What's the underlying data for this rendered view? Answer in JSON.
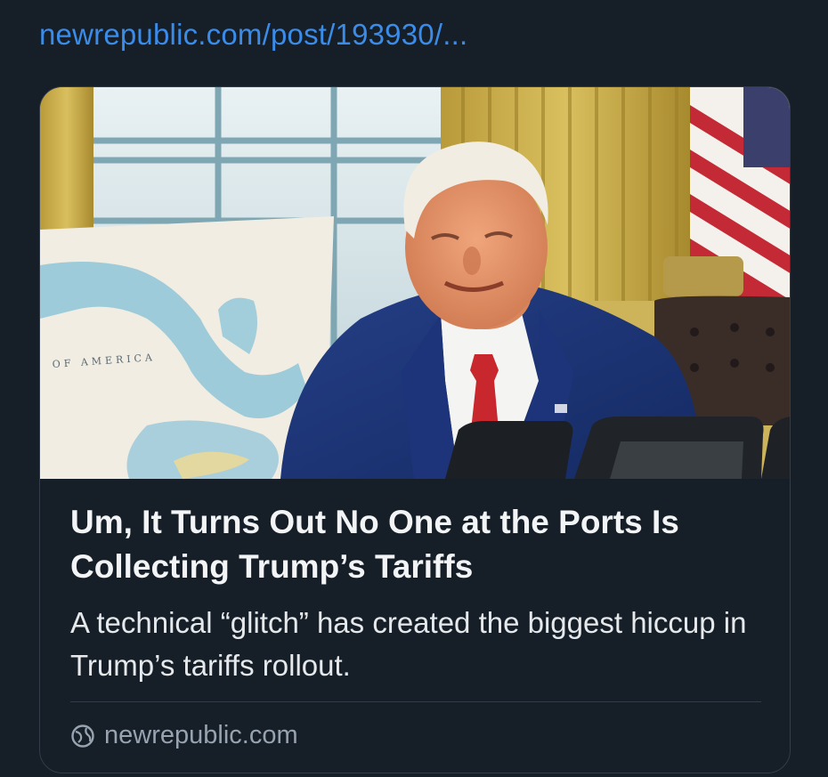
{
  "link": {
    "url_text": "newrepublic.com/post/193930/..."
  },
  "card": {
    "image": {
      "description_icon": "photo-trump-oval-office",
      "map_label": "OF AMERICA"
    },
    "headline": "Um, It Turns Out No One at the Ports Is Collecting Trump’s Tariffs",
    "description": "A technical “glitch” has created the biggest hiccup in Trump’s tariffs rollout.",
    "domain": "newrepublic.com",
    "domain_icon": "globe-icon"
  },
  "colors": {
    "background": "#161e27",
    "link": "#3b8ce8",
    "border": "#323d49",
    "headline": "#f2f4f6",
    "muted": "#97a3b0"
  }
}
